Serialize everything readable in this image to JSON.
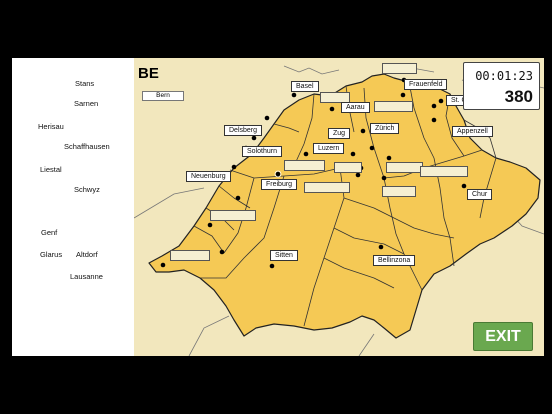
{
  "current_canton": "BE",
  "timer": "00:01:23",
  "score": "380",
  "exit_label": "EXIT",
  "bern_slot_label": "Bern",
  "remaining_names": [
    "Stans",
    "Sarnen",
    "Herisau",
    "Schaffhausen",
    "Liestal",
    "Schwyz",
    "Genf",
    "Glarus",
    "Altdorf",
    "Lausanne"
  ],
  "placed_labels": [
    "Basel",
    "Frauenfeld",
    "Aarau",
    "St. Gallen",
    "Zürich",
    "Zug",
    "Delsberg",
    "Luzern",
    "Appenzell",
    "Solothurn",
    "Neuenburg",
    "Freiburg",
    "Chur",
    "Sitten",
    "Bellinzona"
  ],
  "colors": {
    "map_fill": "#f5c955",
    "background_region": "#f2e7bd",
    "exit_button": "#6aa84f"
  }
}
